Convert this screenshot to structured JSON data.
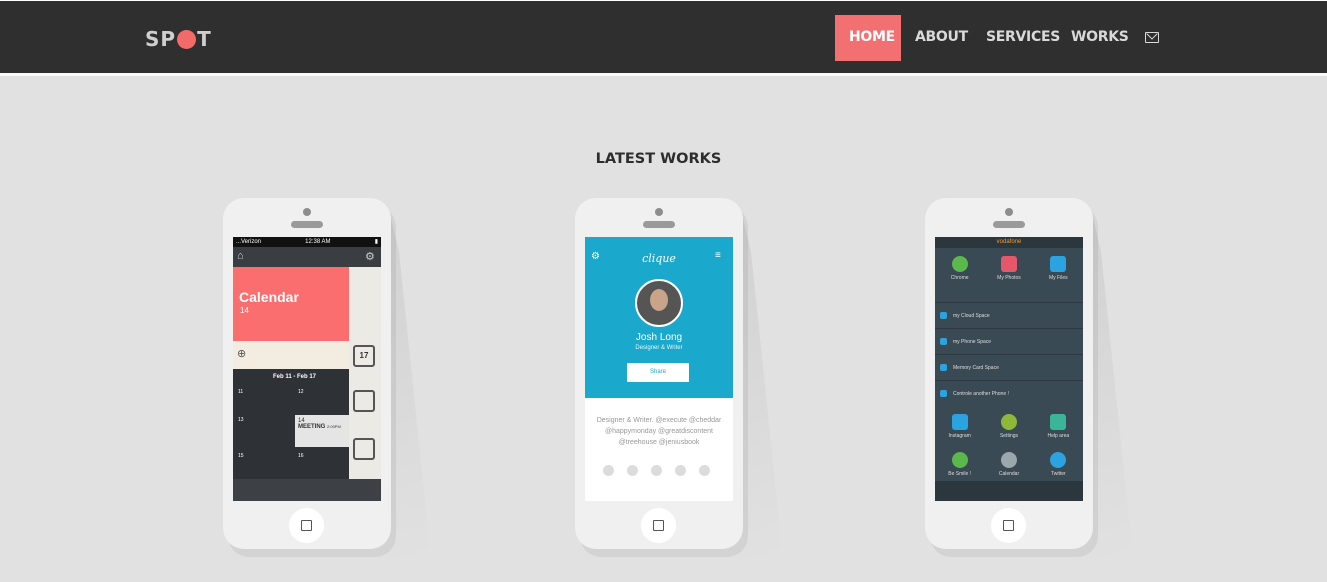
{
  "nav": {
    "logo_left": "SP",
    "logo_right": "T",
    "items": [
      {
        "label": "HOME",
        "active": true
      },
      {
        "label": "ABOUT",
        "active": false
      },
      {
        "label": "SERVICES",
        "active": false
      },
      {
        "label": "WORKS",
        "active": false
      }
    ],
    "mail_icon": "mail-icon"
  },
  "section": {
    "title": "LATEST WORKS"
  },
  "colors": {
    "accent": "#f26f72",
    "nav_bg": "#2f2f2f",
    "page_bg": "#e1e1e1"
  },
  "phones": {
    "calendar": {
      "carrier": "...Verizon",
      "time": "12:38 AM",
      "title": "Calendar",
      "date_num": "14",
      "week": "Feb 11 - Feb 17",
      "days": [
        "11",
        "12",
        "13",
        "14",
        "15",
        "16"
      ],
      "meeting": "MEETING",
      "meeting_time": "2:00PM",
      "badge": "17"
    },
    "profile": {
      "app": "clique",
      "name": "Josh Long",
      "role": "Designer & Writer",
      "share": "Share",
      "bio": "Designer & Writer. @execute @cheddar @happymonday @greatdiscontent @treehouse @jeniusbook"
    },
    "vodafone": {
      "carrier": "vodafone",
      "apps_top": [
        "Chrome",
        "My Photos",
        "My Files"
      ],
      "rows": [
        "my Cloud Space",
        "my Phone Space",
        "Memory Card Space",
        "Controle another Phone !"
      ],
      "apps_mid": [
        "Instagram",
        "Settings",
        "Help area"
      ],
      "apps_bottom": [
        "Be Smile !",
        "Calendar",
        "Twitter"
      ]
    }
  }
}
